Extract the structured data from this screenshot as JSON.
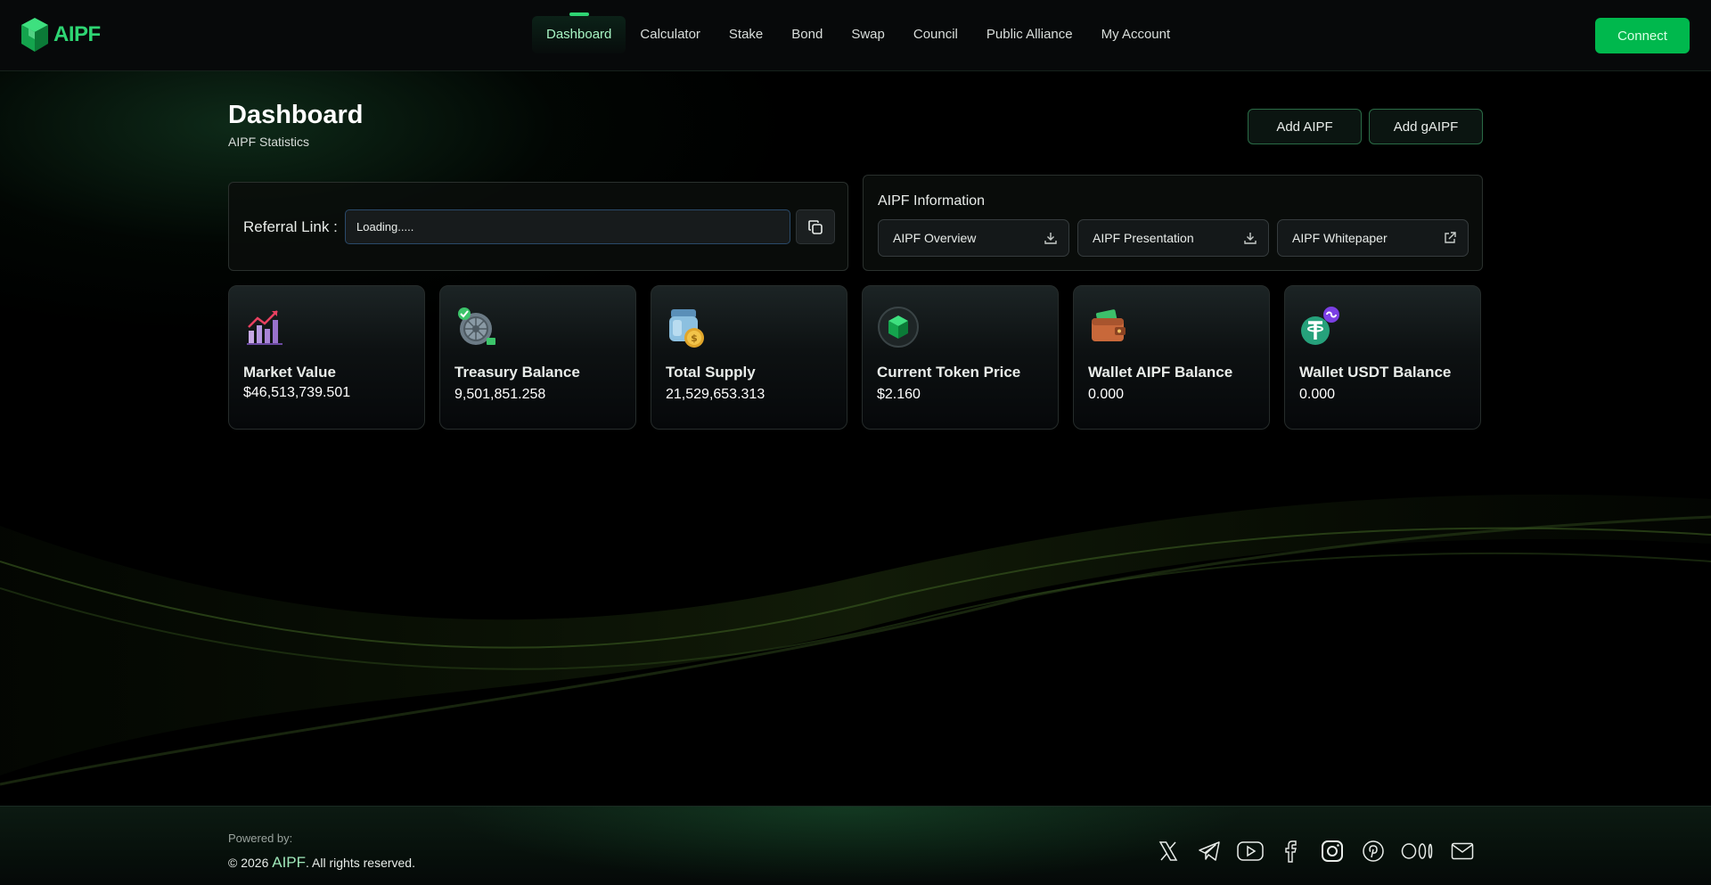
{
  "header": {
    "logo_text": "AIPF",
    "nav": [
      {
        "label": "Dashboard",
        "active": true
      },
      {
        "label": "Calculator"
      },
      {
        "label": "Stake"
      },
      {
        "label": "Bond"
      },
      {
        "label": "Swap"
      },
      {
        "label": "Council"
      },
      {
        "label": "Public Alliance"
      },
      {
        "label": "My Account"
      }
    ],
    "connect_label": "Connect"
  },
  "page": {
    "title": "Dashboard",
    "subtitle": "AIPF Statistics",
    "add_aipf_label": "Add AIPF",
    "add_gaipf_label": "Add gAIPF"
  },
  "referral": {
    "label": "Referral Link :",
    "value": "Loading....."
  },
  "info": {
    "title": "AIPF Information",
    "links": [
      {
        "label": "AIPF Overview",
        "icon": "download-icon"
      },
      {
        "label": "AIPF Presentation",
        "icon": "download-icon"
      },
      {
        "label": "AIPF Whitepaper",
        "icon": "external-link-icon"
      }
    ]
  },
  "cards": [
    {
      "label": "Market Value",
      "value": "$46,513,739.501",
      "icon": "chart-growth-icon"
    },
    {
      "label": "Treasury Balance",
      "value": "9,501,851.258",
      "icon": "vault-icon"
    },
    {
      "label": "Total Supply",
      "value": "21,529,653.313",
      "icon": "coin-jar-icon"
    },
    {
      "label": "Current Token Price",
      "value": "$2.160",
      "icon": "token-cube-icon"
    },
    {
      "label": "Wallet AIPF Balance",
      "value": "0.000",
      "icon": "wallet-icon"
    },
    {
      "label": "Wallet USDT Balance",
      "value": "0.000",
      "icon": "usdt-icon"
    }
  ],
  "footer": {
    "powered_by": "Powered by:",
    "copyright_prefix": "© 2026",
    "brand": "AIPF",
    "copyright_suffix": ". All rights reserved.",
    "socials": [
      "x-icon",
      "telegram-icon",
      "youtube-icon",
      "facebook-icon",
      "instagram-icon",
      "pinterest-icon",
      "medium-icon",
      "email-icon"
    ]
  },
  "colors": {
    "accent": "#00b84d",
    "accent_light": "#2ed573",
    "background": "#000000"
  }
}
